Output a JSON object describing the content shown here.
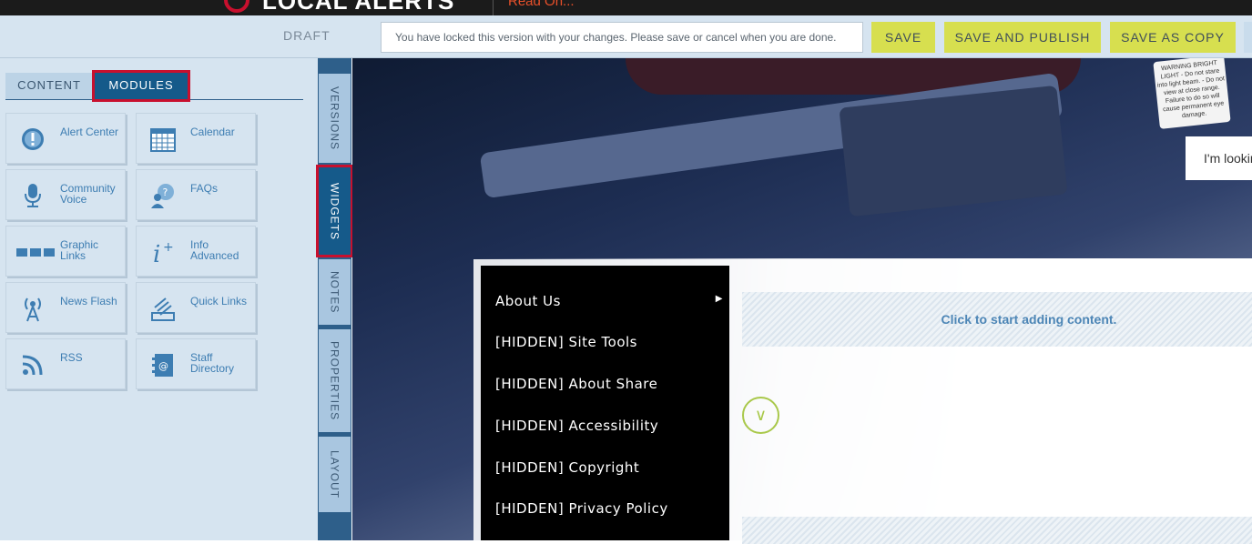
{
  "topbar": {
    "site_name": "LOCAL ALERTS",
    "read_on": "Read On..."
  },
  "toolbar": {
    "status": "DRAFT",
    "lock_message": "You have locked this version with your changes. Please save or cancel when you are done.",
    "save_label": "SAVE",
    "save_publish_label": "SAVE AND PUBLISH",
    "save_copy_label": "SAVE AS COPY"
  },
  "left_panel": {
    "tabs": [
      "CONTENT",
      "MODULES"
    ],
    "active_tab": "MODULES",
    "modules": [
      {
        "label": "Alert Center",
        "icon": "alert-icon"
      },
      {
        "label": "Calendar",
        "icon": "calendar-icon"
      },
      {
        "label": "Community Voice",
        "icon": "microphone-icon"
      },
      {
        "label": "FAQs",
        "icon": "faq-icon"
      },
      {
        "label": "Graphic Links",
        "icon": "graphic-links-icon"
      },
      {
        "label": "Info Advanced",
        "icon": "info-icon"
      },
      {
        "label": "News Flash",
        "icon": "broadcast-icon"
      },
      {
        "label": "Quick Links",
        "icon": "quick-links-icon"
      },
      {
        "label": "RSS",
        "icon": "rss-icon"
      },
      {
        "label": "Staff Directory",
        "icon": "directory-icon"
      }
    ]
  },
  "vertical_tabs": [
    "VERSIONS",
    "WIDGETS",
    "NOTES",
    "PROPERTIES",
    "LAYOUT"
  ],
  "active_vertical_tab": "WIDGETS",
  "hero": {
    "warning_sticker": "WARNING BRIGHT LIGHT - Do not stare into light beam. - Do not view at close range. Failure to do so will cause permanent eye damage.",
    "search_placeholder": "I'm looking"
  },
  "content": {
    "dropzone_text": "Click to start adding content."
  },
  "menu": {
    "items": [
      "About Us",
      "[HIDDEN] Site Tools",
      "[HIDDEN] About Share",
      "[HIDDEN] Accessibility",
      "[HIDDEN] Copyright",
      "[HIDDEN] Privacy Policy"
    ]
  },
  "colors": {
    "accent_button": "#d7df4f",
    "active_tab": "#155a8a",
    "highlight_outline": "#c8102e",
    "panel_bg": "#d6e4f0"
  }
}
